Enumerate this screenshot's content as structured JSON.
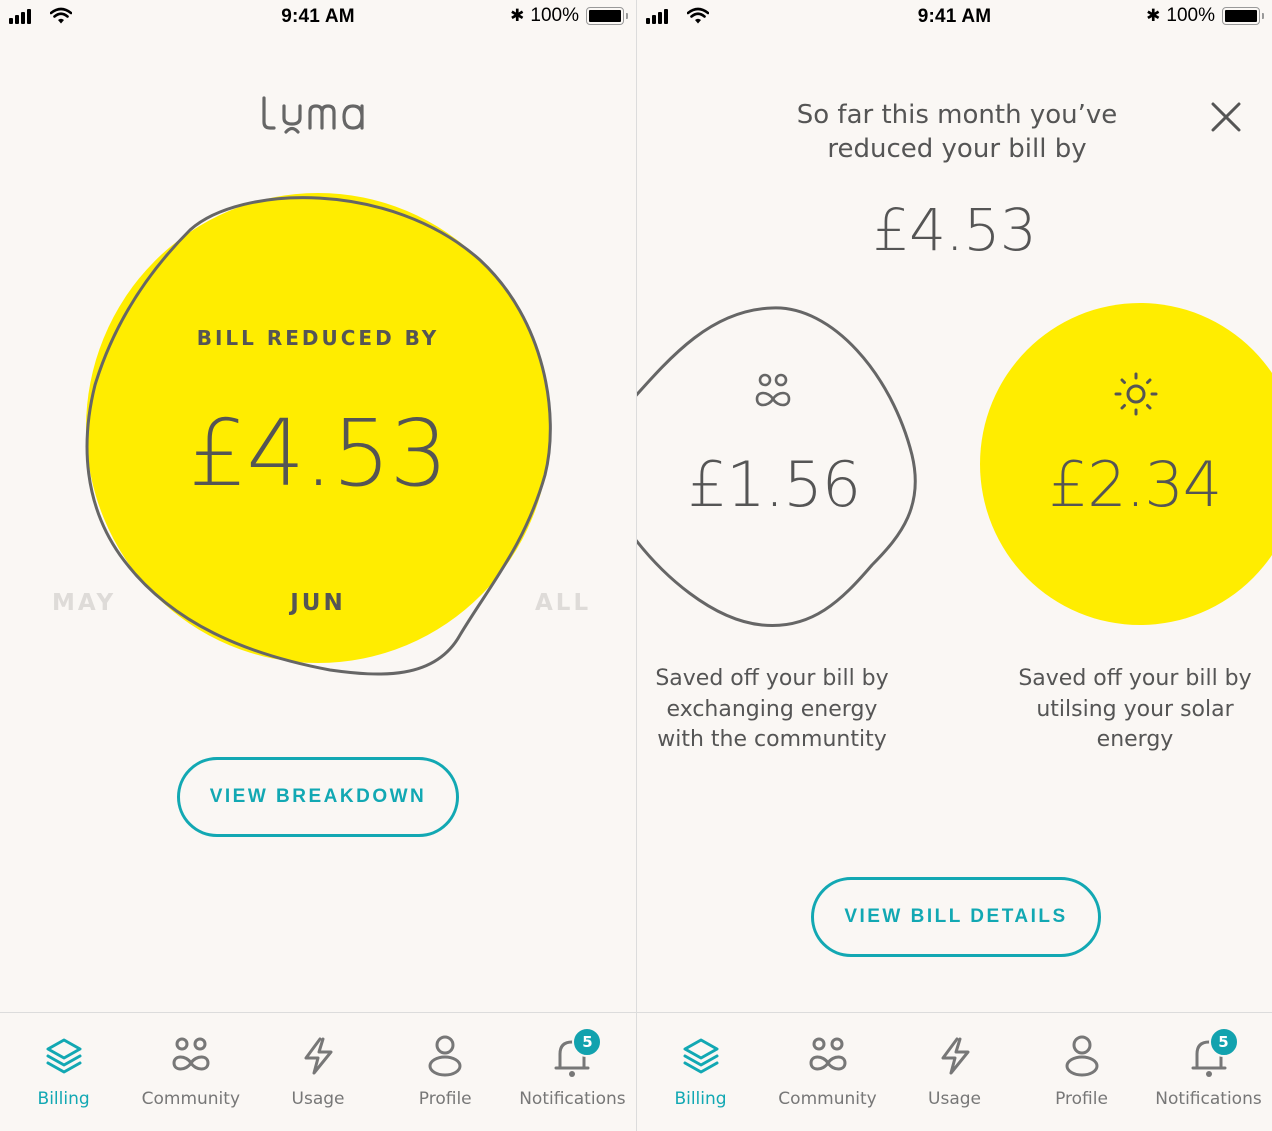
{
  "status_bar": {
    "time": "9:41 AM",
    "battery": "100%",
    "battery_level": 1.0
  },
  "colors": {
    "accent": "#12a8b3",
    "yellow": "#ffed00",
    "text": "#555555",
    "muted": "#dedbd8",
    "background": "#faf7f4"
  },
  "left_screen": {
    "logo": "luma",
    "bill_label": "BILL REDUCED BY",
    "bill_amount": "£4.53",
    "months": {
      "prev": "MAY",
      "current": "JUN",
      "next": "ALL"
    },
    "button_label": "VIEW BREAKDOWN"
  },
  "right_screen": {
    "heading": "So far this month you’ve reduced your bill by",
    "total": "£4.53",
    "close_icon": "close-icon",
    "savings": [
      {
        "icon": "community-icon",
        "amount": "£1.56",
        "description": "Saved off your bill by exchanging energy with the communtity"
      },
      {
        "icon": "sun-icon",
        "amount": "£2.34",
        "description": "Saved off your bill by utilsing your solar energy"
      }
    ],
    "button_label": "VIEW BILL DETAILS"
  },
  "tab_bar": {
    "active": "Billing",
    "tabs": [
      {
        "label": "Billing",
        "icon": "layers-icon"
      },
      {
        "label": "Community",
        "icon": "community-icon"
      },
      {
        "label": "Usage",
        "icon": "lightning-icon"
      },
      {
        "label": "Profile",
        "icon": "person-icon"
      },
      {
        "label": "Notifications",
        "icon": "bell-icon",
        "badge": "5"
      }
    ]
  }
}
